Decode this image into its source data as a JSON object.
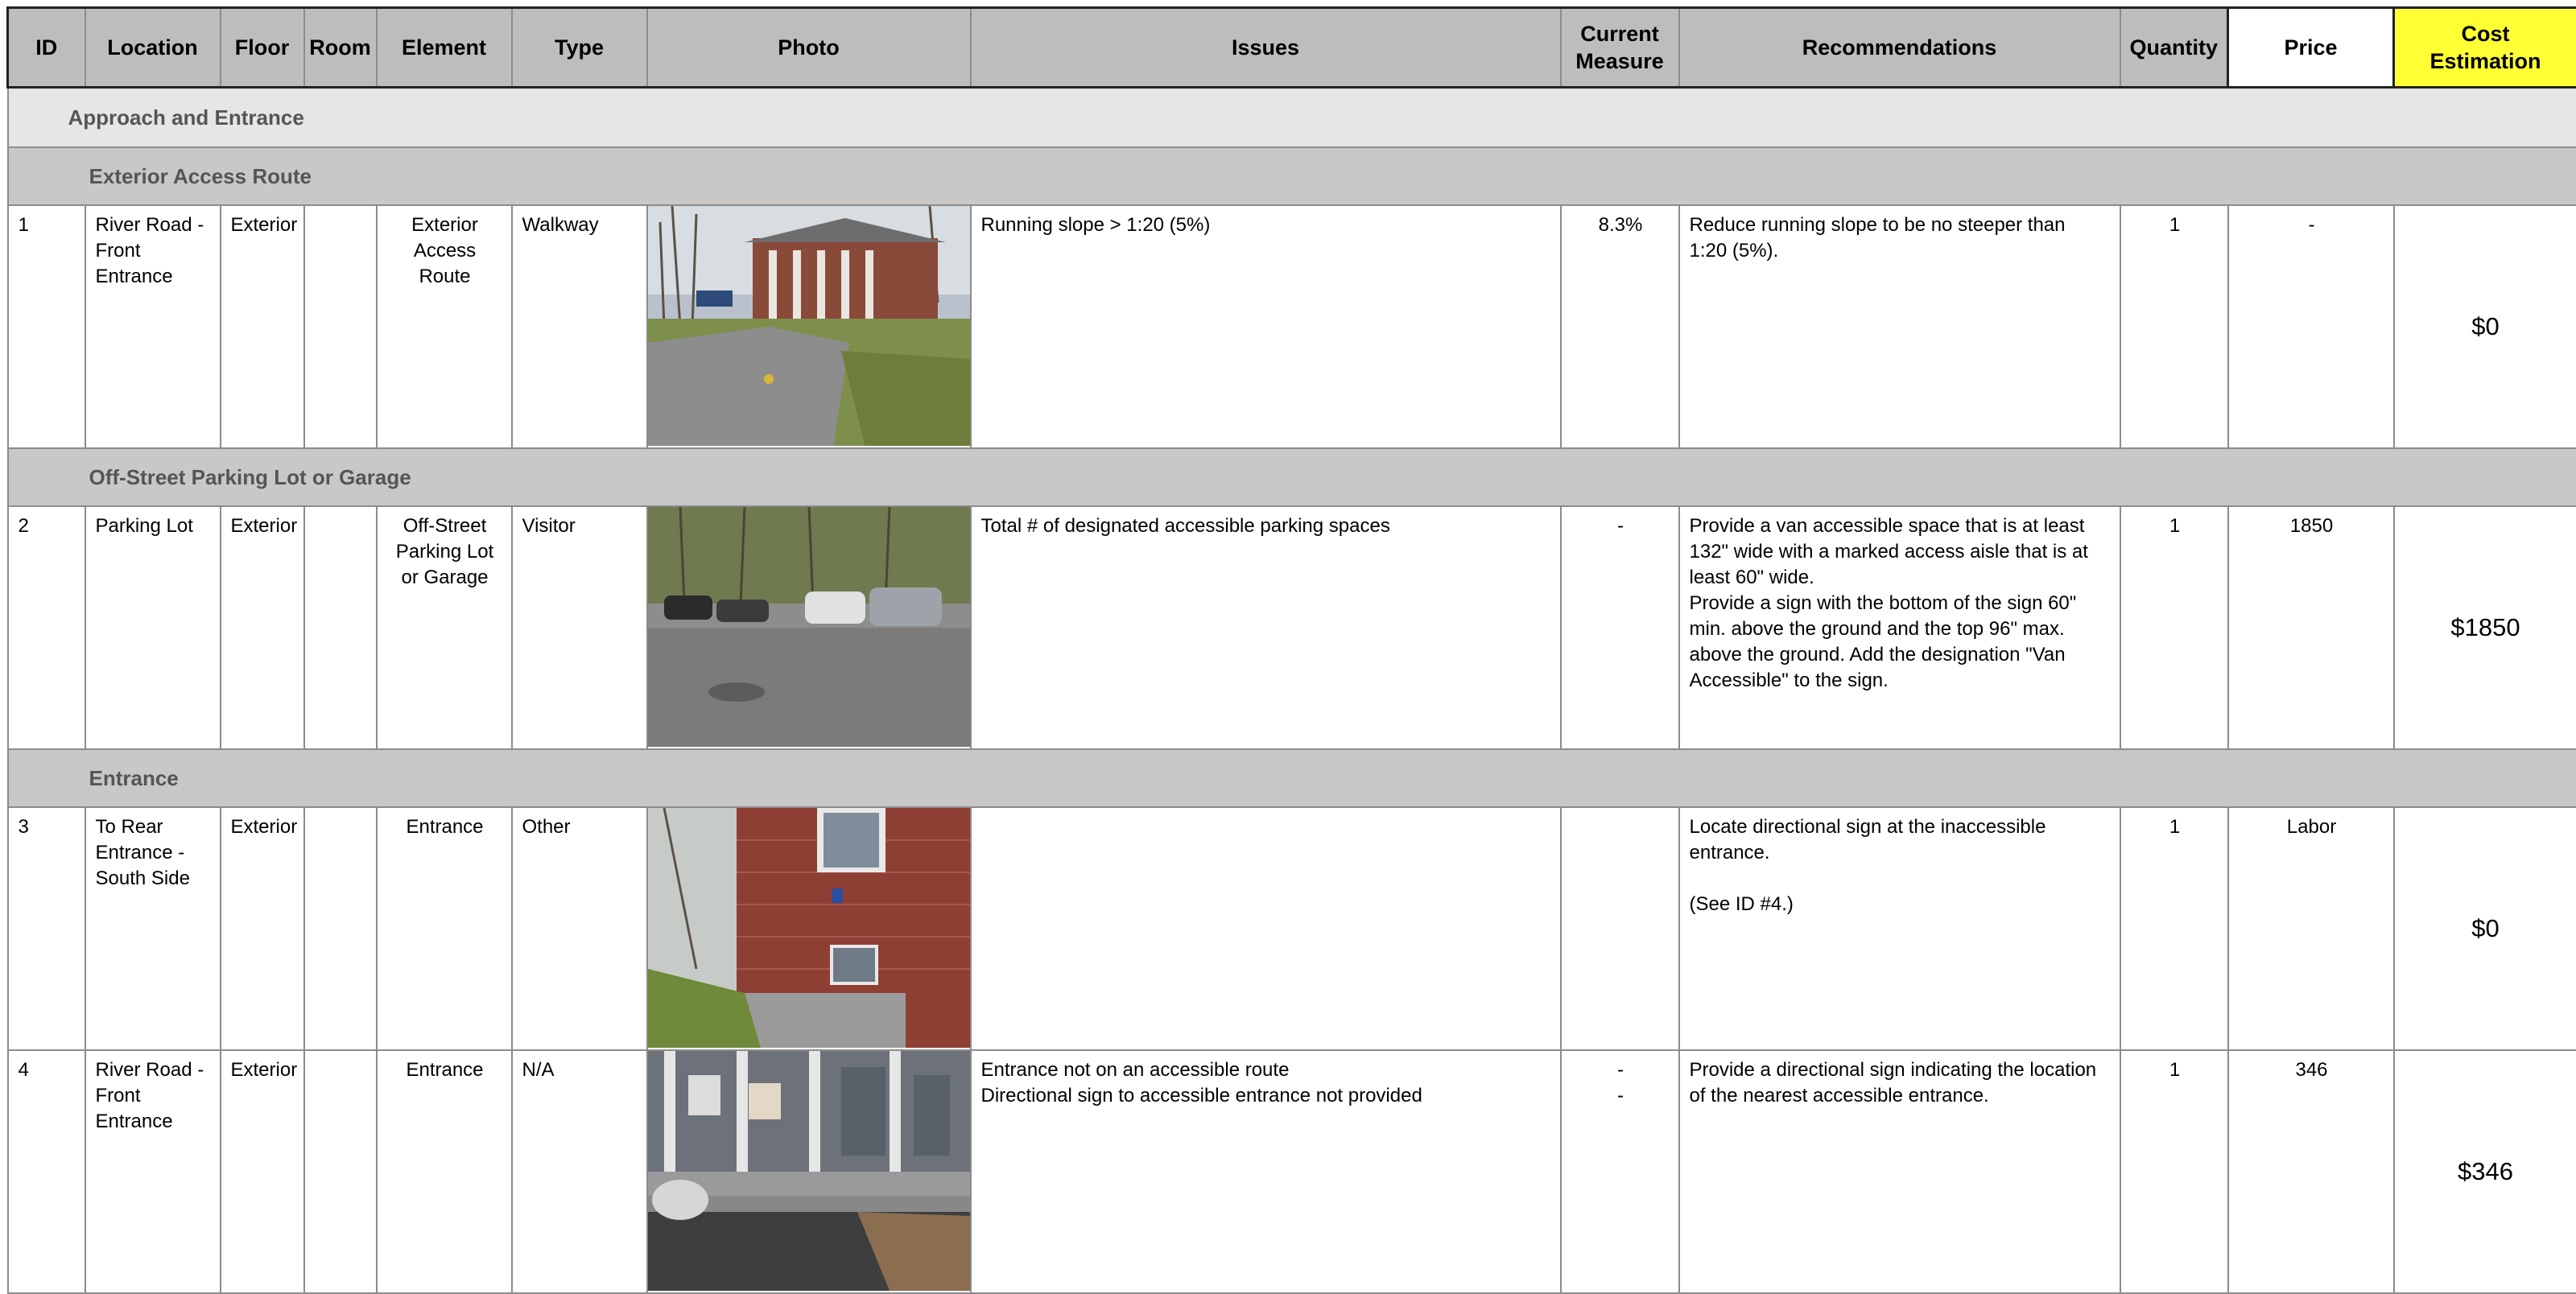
{
  "columns": {
    "id": "ID",
    "location": "Location",
    "floor": "Floor",
    "room": "Room",
    "element": "Element",
    "type": "Type",
    "photo": "Photo",
    "issues": "Issues",
    "current_measure": "Current\nMeasure",
    "recommendations": "Recommendations",
    "quantity": "Quantity",
    "price": "Price",
    "cost_estimation": "Cost\nEstimation"
  },
  "sections": {
    "approach": "Approach and Entrance",
    "exterior_route": "Exterior Access Route",
    "parking": "Off-Street Parking Lot or Garage",
    "entrance": "Entrance"
  },
  "rows": [
    {
      "id": "1",
      "location": "River Road -\nFront\nEntrance",
      "floor": "Exterior",
      "room": "",
      "element": "Exterior\nAccess\nRoute",
      "type": "Walkway",
      "photo_icon": "building-walkway-photo",
      "issues": "Running slope > 1:20 (5%)",
      "current_measure": "8.3%",
      "recommendations": "Reduce running slope to be no steeper than\n1:20 (5%).",
      "quantity": "1",
      "price": "-",
      "cost": "$0"
    },
    {
      "id": "2",
      "location": "Parking Lot",
      "floor": "Exterior",
      "room": "",
      "element": "Off-Street\nParking Lot\nor Garage",
      "type": "Visitor",
      "photo_icon": "parking-lot-photo",
      "issues": "Total # of designated accessible parking spaces",
      "current_measure": "-",
      "recommendations": "Provide a van accessible space that is at least\n132\" wide with a marked access aisle that is at\nleast 60\" wide.\nProvide a sign with the bottom of the sign 60\"\nmin. above the ground and the top 96\" max.\nabove the ground. Add the designation \"Van\nAccessible\" to the sign.",
      "quantity": "1",
      "price": "1850",
      "cost": "$1850"
    },
    {
      "id": "3",
      "location": "To Rear\nEntrance -\nSouth Side",
      "floor": "Exterior",
      "room": "",
      "element": "Entrance",
      "type": "Other",
      "photo_icon": "brick-wall-photo",
      "issues": "",
      "current_measure": "",
      "recommendations": "Locate directional sign at the inaccessible\nentrance.\n\n(See ID #4.)",
      "quantity": "1",
      "price": "Labor",
      "cost": "$0"
    },
    {
      "id": "4",
      "location": "River Road -\nFront\nEntrance",
      "floor": "Exterior",
      "room": "",
      "element": "Entrance",
      "type": "N/A",
      "photo_icon": "front-porch-photo",
      "issues": "Entrance not on an accessible route\nDirectional sign to accessible entrance not provided",
      "current_measure": "-\n-",
      "recommendations": "Provide a directional sign indicating the location\nof the nearest accessible entrance.",
      "quantity": "1",
      "price": "346",
      "cost": "$346"
    }
  ]
}
